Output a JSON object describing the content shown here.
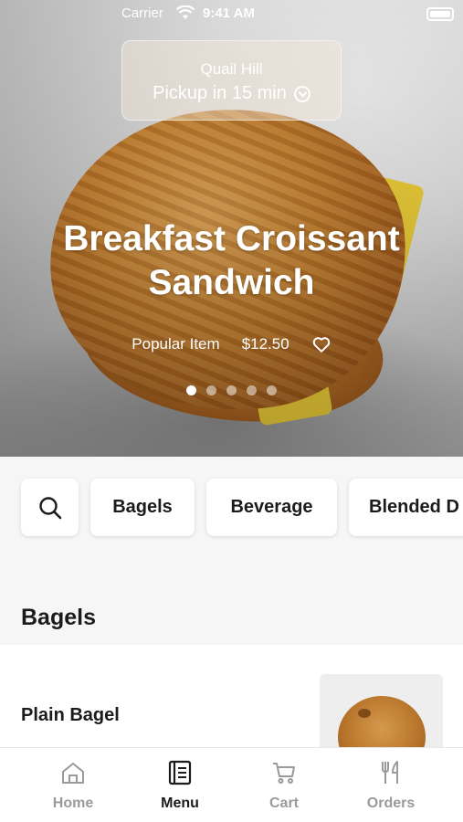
{
  "status_bar": {
    "carrier": "Carrier",
    "time": "9:41 AM"
  },
  "location": {
    "name": "Quail Hill",
    "pickup": "Pickup in 15 min"
  },
  "hero": {
    "title": "Breakfast Croissant Sandwich",
    "badge": "Popular Item",
    "price": "$12.50",
    "page_count": 5,
    "active_page": 1
  },
  "categories": {
    "search_icon": "search-icon",
    "items": [
      "Bagels",
      "Beverage",
      "Blended D"
    ]
  },
  "section": {
    "title": "Bagels"
  },
  "items": [
    {
      "name": "Plain Bagel"
    }
  ],
  "tabs": [
    {
      "label": "Home",
      "icon": "home-icon",
      "active": false
    },
    {
      "label": "Menu",
      "icon": "menu-book-icon",
      "active": true
    },
    {
      "label": "Cart",
      "icon": "cart-icon",
      "active": false
    },
    {
      "label": "Orders",
      "icon": "fork-knife-icon",
      "active": false
    }
  ],
  "colors": {
    "active_tab": "#1b1b1b",
    "inactive_tab": "#9a9a9a"
  }
}
